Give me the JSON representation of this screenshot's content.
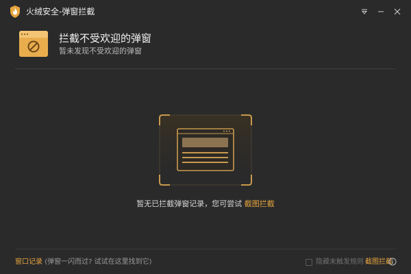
{
  "colors": {
    "background": "#2a2a2a",
    "accent": "#e6a53f",
    "divider": "#3e3e3e"
  },
  "titlebar": {
    "title": "火绒安全-弹窗拦截",
    "icons": {
      "logo": "shield-flame-icon",
      "menu": "menu-down-icon",
      "minimize": "minimize-icon",
      "close": "close-icon"
    }
  },
  "header": {
    "icon": "blocked-window-icon",
    "title": "拦截不受欢迎的弹窗",
    "subtitle": "暂未发现不受欢迎的弹窗"
  },
  "empty_state": {
    "illustration": "window-screenshot-illustration",
    "text": "暂无已拦截弹窗记录，您可尝试",
    "link": "截图拦截"
  },
  "footer": {
    "history_link": "窗口记录",
    "history_hint": "(弹窗一闪而过? 试试在这里找到它)",
    "hide_rules_label": "隐藏未触发规则",
    "hide_rules_checked": false,
    "screenshot_block_link": "截图拦截",
    "info_icon": "info-icon"
  }
}
